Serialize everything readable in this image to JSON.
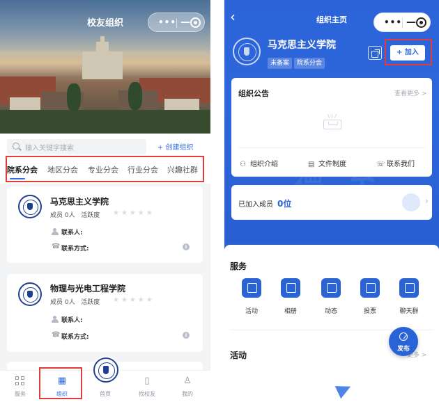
{
  "left": {
    "title": "校友组织",
    "search": {
      "placeholder": "输入关键字搜索"
    },
    "create_label": "+ 创建组织",
    "tabs": [
      "院系分会",
      "地区分会",
      "专业分会",
      "行业分会",
      "兴趣社群"
    ],
    "active_tab": 0,
    "orgs": [
      {
        "name": "马克思主义学院",
        "members": "成员 0人",
        "activity_label": "活跃度",
        "rating": 0,
        "contact_label": "联系人:",
        "contact_method_label": "联系方式:"
      },
      {
        "name": "物理与光电工程学院",
        "members": "成员 0人",
        "activity_label": "活跃度",
        "rating": 0,
        "contact_label": "联系人:",
        "contact_method_label": "联系方式:"
      }
    ],
    "nav": [
      {
        "label": "服务",
        "icon": "grid-icon"
      },
      {
        "label": "组织",
        "icon": "building-icon"
      },
      {
        "label": "首页",
        "icon": "home-logo"
      },
      {
        "label": "找校友",
        "icon": "book-icon"
      },
      {
        "label": "我的",
        "icon": "user-icon"
      }
    ],
    "active_nav": 1
  },
  "right": {
    "title": "组织主页",
    "org_name": "马克思主义学院",
    "tags": [
      "未备案",
      "院系分会"
    ],
    "join_label": "+ 加入",
    "announcement": {
      "title": "组织公告",
      "see_more": "查看更多 >"
    },
    "links": [
      {
        "label": "组织介绍",
        "icon": "people-icon"
      },
      {
        "label": "文件制度",
        "icon": "document-icon"
      },
      {
        "label": "联系我们",
        "icon": "phone-icon"
      }
    ],
    "members": {
      "label": "已加入成员",
      "count": "0位"
    },
    "services": {
      "title": "服务",
      "items": [
        {
          "label": "活动",
          "icon": "flag-icon"
        },
        {
          "label": "相册",
          "icon": "photo-icon"
        },
        {
          "label": "动态",
          "icon": "star-icon"
        },
        {
          "label": "投票",
          "icon": "vote-icon"
        },
        {
          "label": "聊天群",
          "icon": "chat-icon"
        }
      ]
    },
    "activities": {
      "title": "活动",
      "see_more": "更多 >"
    },
    "fab_label": "发布"
  },
  "colors": {
    "accent": "#2a63d6",
    "highlight_box": "#e23b3b"
  }
}
